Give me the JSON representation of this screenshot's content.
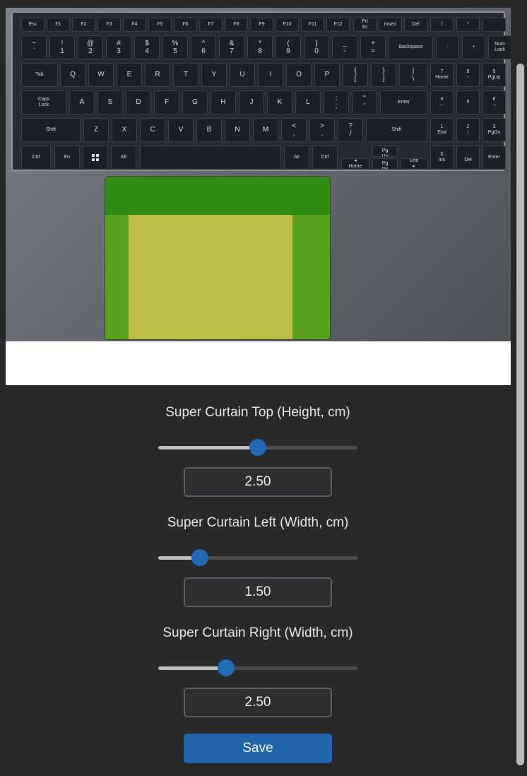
{
  "keyboard": {
    "fn_row": [
      "Esc",
      "F1",
      "F2",
      "F3",
      "F4",
      "F5",
      "F6",
      "F7",
      "F8",
      "F9",
      "F10",
      "F11",
      "F12",
      "Prt Sc",
      "Insert",
      "Del",
      "/",
      "*",
      ""
    ],
    "num_row": [
      [
        "~",
        "`"
      ],
      [
        "!",
        "1"
      ],
      [
        "@",
        "2"
      ],
      [
        "#",
        "3"
      ],
      [
        "$",
        "4"
      ],
      [
        "%",
        "5"
      ],
      [
        "^",
        "6"
      ],
      [
        "&",
        "7"
      ],
      [
        "*",
        "8"
      ],
      [
        "(",
        "9"
      ],
      [
        ")",
        "0"
      ],
      [
        "_",
        "-"
      ],
      [
        "+",
        "="
      ],
      [
        "Backspace",
        ""
      ],
      [
        "-",
        ""
      ],
      [
        "+",
        ""
      ],
      [
        "Num",
        "Lock"
      ]
    ],
    "q_row": [
      "Tab",
      "Q",
      "W",
      "E",
      "R",
      "T",
      "Y",
      "U",
      "I",
      "O",
      "P",
      "{ [",
      "} ]",
      "| \\",
      "7 Home",
      "8 ↑",
      "9 PgUp"
    ],
    "a_row": [
      "Caps Lock",
      "A",
      "S",
      "D",
      "F",
      "G",
      "H",
      "J",
      "K",
      "L",
      ": ;",
      "\" '",
      "Enter",
      "4 ←",
      "5",
      "6 →"
    ],
    "z_row": [
      "Shift",
      "Z",
      "X",
      "C",
      "V",
      "B",
      "N",
      "M",
      "< ,",
      "> .",
      "? /",
      "Shift",
      "1 End",
      "2 ↓",
      "3 PgDn"
    ],
    "bottom_row": [
      "Ctrl",
      "Fn",
      "",
      "Alt",
      "",
      "Alt",
      "Ctrl",
      "◂ Home",
      "▴ Pg Up",
      "▾ Pg Dn",
      "End ▸",
      "0 Ins",
      ". Del",
      "Enter"
    ]
  },
  "touchpad_zones": {
    "top_color": "#2e8b14",
    "side_color": "#58a21e",
    "center_color": "#bcbd46"
  },
  "controls": {
    "top": {
      "label": "Super Curtain Top (Height, cm)",
      "value": "2.50",
      "fraction": 0.5
    },
    "left": {
      "label": "Super Curtain Left (Width, cm)",
      "value": "1.50",
      "fraction": 0.21
    },
    "right": {
      "label": "Super Curtain Right (Width, cm)",
      "value": "2.50",
      "fraction": 0.34
    }
  },
  "save_label": "Save",
  "accent_color": "#2169b3"
}
